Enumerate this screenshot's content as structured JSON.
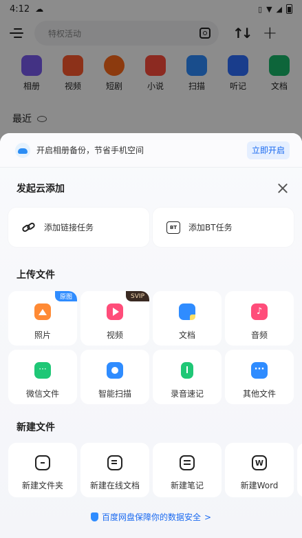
{
  "status_bar": {
    "time": "4:12"
  },
  "header": {
    "search_placeholder": "特权活动"
  },
  "apps": [
    {
      "label": "相册",
      "color": "#7b5cf0"
    },
    {
      "label": "视频",
      "color": "#ff5a2e"
    },
    {
      "label": "短剧",
      "color": "#ff6a1a"
    },
    {
      "label": "小说",
      "color": "#ff4d3d"
    },
    {
      "label": "扫描",
      "color": "#2f8cff"
    },
    {
      "label": "听记",
      "color": "#2f6fff"
    },
    {
      "label": "文档",
      "color": "#19b86b"
    }
  ],
  "recent": {
    "label": "最近"
  },
  "banner": {
    "text": "开启相册备份，节省手机空间",
    "button": "立即开启"
  },
  "cloud_add": {
    "title": "发起云添加",
    "items": [
      {
        "label": "添加链接任务"
      },
      {
        "label": "添加BT任务",
        "icon_text": "BT"
      }
    ]
  },
  "upload": {
    "title": "上传文件",
    "items": [
      {
        "label": "照片",
        "tag": "原图",
        "tag_color": "#2f8cff"
      },
      {
        "label": "视频",
        "tag": "SVIP",
        "tag_color": "#3a2a22"
      },
      {
        "label": "文档"
      },
      {
        "label": "音频"
      },
      {
        "label": "微信文件"
      },
      {
        "label": "智能扫描"
      },
      {
        "label": "录音速记"
      },
      {
        "label": "其他文件"
      }
    ]
  },
  "new_file": {
    "title": "新建文件",
    "items": [
      {
        "label": "新建文件夹"
      },
      {
        "label": "新建在线文档"
      },
      {
        "label": "新建笔记"
      },
      {
        "label": "新建Word",
        "icon_text": "W"
      }
    ]
  },
  "footer": {
    "text": "百度网盘保障你的数据安全",
    "chevron": ">"
  }
}
